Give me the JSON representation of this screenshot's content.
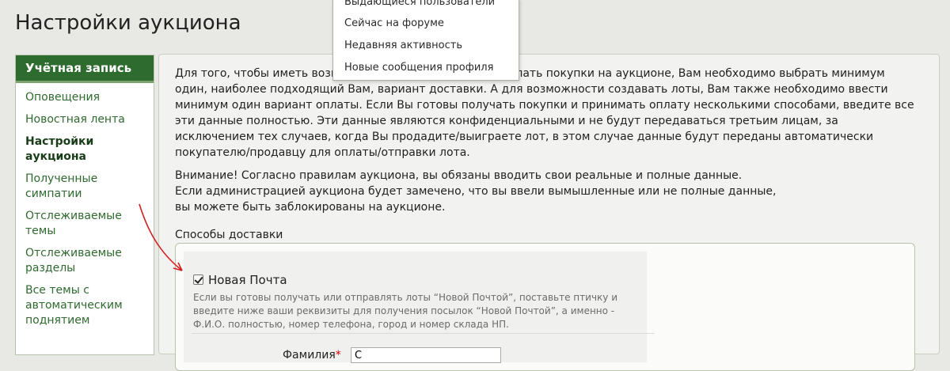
{
  "page": {
    "title": "Настройки аукциона"
  },
  "sidebar": {
    "header": "Учётная запись",
    "items": [
      {
        "label": "Оповещения",
        "active": false
      },
      {
        "label": "Новостная лента",
        "active": false
      },
      {
        "label": "Настройки аукциона",
        "active": true
      },
      {
        "label": "Полученные симпатии",
        "active": false
      },
      {
        "label": "Отслеживаемые темы",
        "active": false
      },
      {
        "label": "Отслеживаемые разделы",
        "active": false
      },
      {
        "label": "Все темы с автоматическим поднятием",
        "active": false
      }
    ]
  },
  "dropdown": {
    "items": [
      "Выдающиеся пользователи",
      "Сейчас на форуме",
      "Недавняя активность",
      "Новые сообщения профиля"
    ]
  },
  "main": {
    "intro": "Для того, чтобы иметь возможность продавать лоты и делать покупки на аукционе, Вам необходимо выбрать минимум один, наиболее подходящий Вам, вариант доставки. А для возможности создавать лоты, Вам также необходимо ввести минимум один вариант оплаты. Если Вы готовы получать покупки и принимать оплату несколькими способами, введите все эти данные полностью. Эти данные являются конфиденциальными и не будут передаваться третьим лицам, за исключением тех случаев, когда Вы продадите/выиграете лот, в этом случае данные будут переданы автоматически покупателю/продавцу для оплаты/отправки лота.",
    "warning_line1": "Внимание! Согласно правилам аукциона, вы обязаны вводить свои реальные и полные данные.",
    "warning_line2": "Если администрацией аукциона будет замечено, что вы ввели вымышленные или не полные данные,",
    "warning_line3": "вы можете быть заблокированы на аукционе.",
    "delivery_section_label": "Способы доставки",
    "nova_poshta": {
      "label": "Новая Почта",
      "checked": true,
      "description": "Если вы готовы получать или отправлять лоты “Новой Почтой”, поставьте птичку и введите ниже ваши реквизиты для получения посылок “Новой Почтой”, а именно - Ф.И.О. полностью, номер телефона, город и номер склада НП.",
      "field_label": "Фамилия",
      "field_required_mark": "*",
      "field_value": "С"
    }
  },
  "colors": {
    "sidebar_header_bg": "#2e6b2e",
    "link_green": "#2f6a2f",
    "annotation_arrow": "#d42020"
  }
}
